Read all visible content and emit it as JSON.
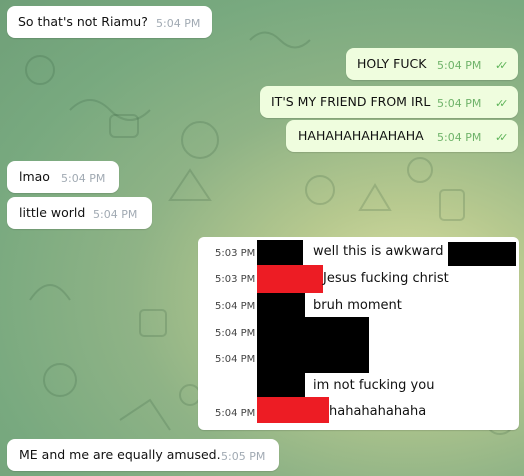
{
  "colors": {
    "incoming_bubble": "#ffffff",
    "outgoing_bubble": "#effdde",
    "read_check": "#5fb45a",
    "redaction_black": "#000000",
    "redaction_red": "#ed1c24"
  },
  "messages": [
    {
      "direction": "incoming",
      "text": "So that's not Riamu?",
      "time": "5:04 PM"
    },
    {
      "direction": "outgoing",
      "text": "HOLY FUCK",
      "time": "5:04 PM",
      "status_icon": "double-check-icon"
    },
    {
      "direction": "outgoing",
      "text": "IT'S MY FRIEND FROM IRL",
      "time": "5:04 PM",
      "status_icon": "double-check-icon"
    },
    {
      "direction": "outgoing",
      "text": "HAHAHAHAHAHAHA",
      "time": "5:04 PM",
      "status_icon": "double-check-icon"
    },
    {
      "direction": "incoming",
      "text": "lmao",
      "time": "5:04 PM"
    },
    {
      "direction": "incoming",
      "text": "little world",
      "time": "5:04 PM"
    }
  ],
  "embedded_screenshot": {
    "lines": [
      {
        "time": "5:03 PM",
        "text": "well this is awkward"
      },
      {
        "time": "5:03 PM",
        "text": "Jesus fucking christ"
      },
      {
        "time": "5:04 PM",
        "text": "bruh moment"
      },
      {
        "time": "5:04 PM",
        "text": ""
      },
      {
        "time": "5:04 PM",
        "text": ""
      },
      {
        "time": "",
        "text": "im not fucking you"
      },
      {
        "time": "5:04 PM",
        "text": "hahahahahaha"
      }
    ]
  },
  "last_message": {
    "direction": "incoming",
    "text": "ME and me are equally amused.",
    "time": "5:05 PM"
  }
}
